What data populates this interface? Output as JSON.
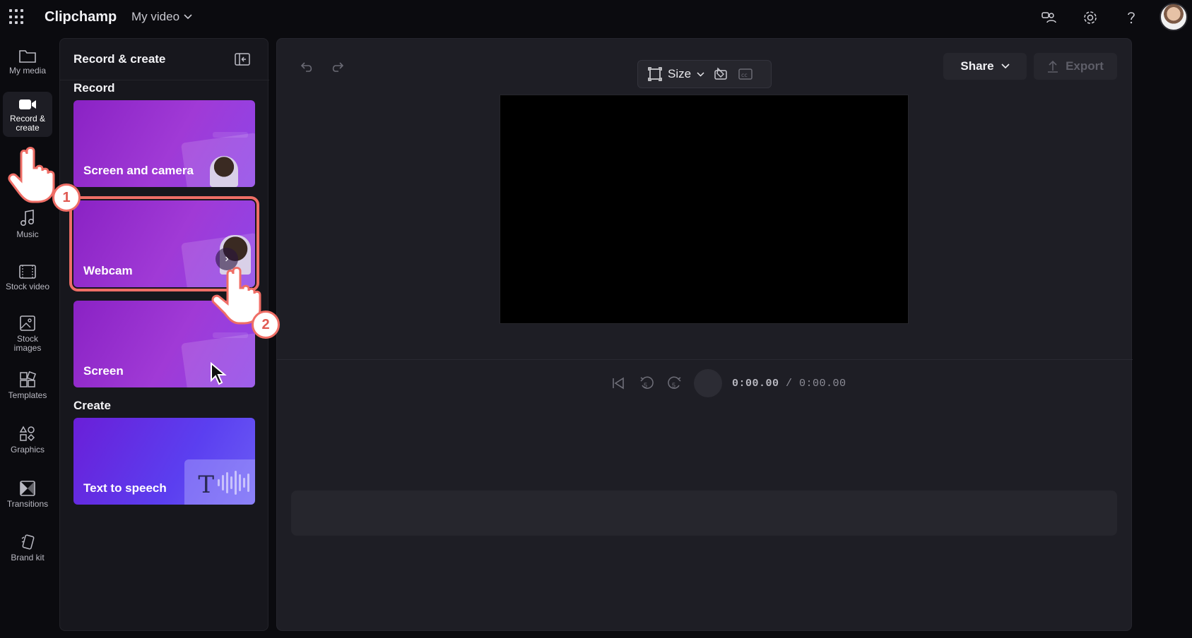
{
  "app": {
    "brand": "Clipchamp",
    "project_name": "My video",
    "icons": [
      "apps-grid-icon",
      "feedback-icon",
      "settings-gear-icon",
      "help-icon",
      "user-avatar"
    ]
  },
  "rail": {
    "items": [
      {
        "label": "My media",
        "icon": "folder-icon"
      },
      {
        "label": "Record & create",
        "icon": "camera-icon",
        "active": true
      },
      {
        "label": "Music",
        "icon": "music-note-icon"
      },
      {
        "label": "Stock video",
        "icon": "film-icon"
      },
      {
        "label": "Stock images",
        "icon": "image-icon"
      },
      {
        "label": "Templates",
        "icon": "templates-icon"
      },
      {
        "label": "Graphics",
        "icon": "shapes-icon"
      },
      {
        "label": "Transitions",
        "icon": "transition-icon"
      },
      {
        "label": "Brand kit",
        "icon": "brand-kit-icon"
      }
    ]
  },
  "panel": {
    "title": "Record & create",
    "record_heading": "Record",
    "create_heading": "Create",
    "cards": [
      {
        "label": "Screen and camera"
      },
      {
        "label": "Webcam",
        "selected": true
      },
      {
        "label": "Screen"
      },
      {
        "label": "Text to speech",
        "glyph": "T"
      }
    ]
  },
  "editor": {
    "toolbar": {
      "size_label": "Size"
    },
    "share_label": "Share",
    "export_label": "Export",
    "time_current": "0:00.00",
    "time_separator": " / ",
    "time_total": "0:00.00",
    "skip_back_label": "5",
    "skip_forward_label": "5"
  },
  "annotations": {
    "step1": "1",
    "step2": "2",
    "accent_color": "#ef6e66"
  }
}
